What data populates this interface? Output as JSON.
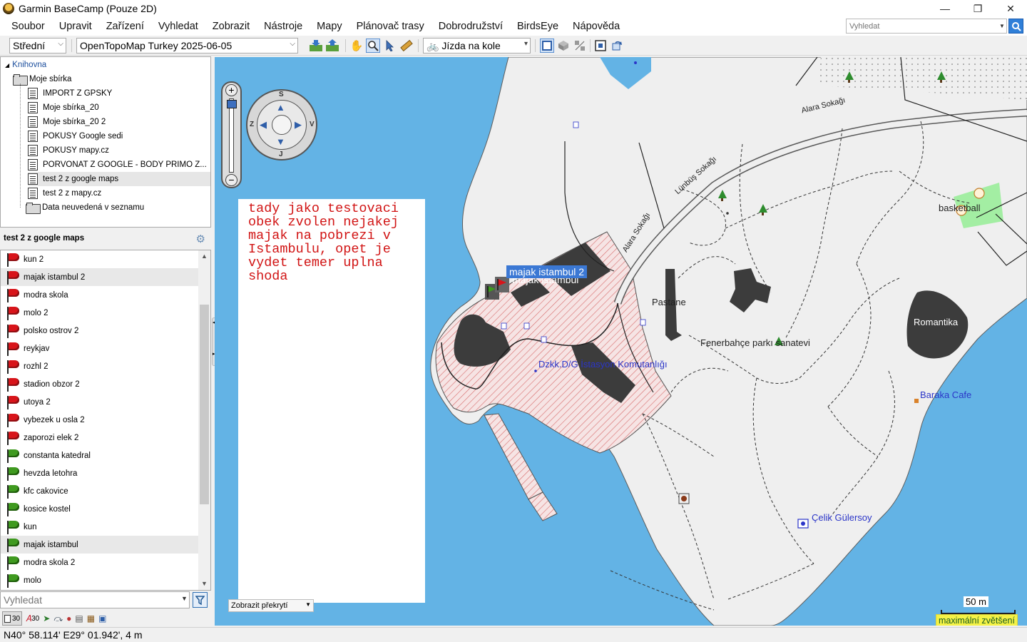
{
  "window": {
    "title": "Garmin BaseCamp (Pouze 2D)",
    "controls": [
      "—",
      "❐",
      "✕"
    ]
  },
  "menu": [
    "Soubor",
    "Upravit",
    "Zařízení",
    "Vyhledat",
    "Zobrazit",
    "Nástroje",
    "Mapy",
    "Plánovač trasy",
    "Dobrodružství",
    "BirdsEye",
    "Nápověda"
  ],
  "top_search": {
    "placeholder": "Vyhledat"
  },
  "toolbar": {
    "detail_level": "Střední",
    "map_product": "OpenTopoMap Turkey 2025-06-05",
    "activity_profile": "Jízda na kole"
  },
  "library": {
    "root": "Knihovna",
    "collection": "Moje sbírka",
    "items": [
      "IMPORT Z GPSKY",
      "Moje sbírka_20",
      "Moje sbírka_20 2",
      "POKUSY Google sedi",
      "POKUSY mapy.cz",
      "PORVONAT Z GOOGLE - BODY PRIMO Z...",
      "test 2 z google maps",
      "test 2 z mapy.cz"
    ],
    "selected_index": 6,
    "unlisted": "Data neuvedená v seznamu"
  },
  "list": {
    "header": "test 2 z google maps",
    "items": [
      {
        "label": "kun 2",
        "flag": "red"
      },
      {
        "label": "majak istambul 2",
        "flag": "red",
        "selected": true
      },
      {
        "label": "modra skola",
        "flag": "red"
      },
      {
        "label": "molo 2",
        "flag": "red"
      },
      {
        "label": "polsko ostrov 2",
        "flag": "red"
      },
      {
        "label": "reykjav",
        "flag": "red"
      },
      {
        "label": "rozhl 2",
        "flag": "red"
      },
      {
        "label": "stadion obzor 2",
        "flag": "red"
      },
      {
        "label": "utoya 2",
        "flag": "red"
      },
      {
        "label": "vybezek u osla 2",
        "flag": "red"
      },
      {
        "label": "zaporozi elek 2",
        "flag": "red"
      },
      {
        "label": "constanta katedral",
        "flag": "green"
      },
      {
        "label": "hevzda letohra",
        "flag": "green"
      },
      {
        "label": "kfc cakovice",
        "flag": "green"
      },
      {
        "label": "kosice kostel",
        "flag": "green"
      },
      {
        "label": "kun",
        "flag": "green"
      },
      {
        "label": "majak istambul",
        "flag": "green",
        "selected": true
      },
      {
        "label": "modra skola 2",
        "flag": "green"
      },
      {
        "label": "molo",
        "flag": "green"
      }
    ]
  },
  "search": {
    "placeholder": "Vyhledat"
  },
  "bottom_counts": {
    "lists": "30",
    "tracks": "30"
  },
  "map": {
    "note": "tady jako testovaci\nobek zvolen nejakej\nmajak na pobrezi v\nIstambulu, opet je\nvydet temer uplna\nshoda",
    "waypoint_label": "majak istambul 2",
    "waypoint_label_behind": "majak istambul",
    "labels": {
      "pastane": "Pastane",
      "park": "Fenerbahçe parkı sanatevi",
      "dzkk": "Dzkk.D/G İstasyon Komutanlığı",
      "romantika": "Romantika",
      "basketball": "basketball",
      "baraka": "Baraka Cafe",
      "celik": "Çelik Gülersoy",
      "road1": "Alara Sokağı",
      "road2": "Lünbüş Sokağı",
      "road3": "Alara Sokağı"
    },
    "overlay_select": "Zobrazit překrytí",
    "scale": "50 m",
    "zoom_status": "maximální zvětšení",
    "compass": {
      "n": "S",
      "s": "J",
      "w": "Z",
      "e": "V"
    }
  },
  "status": {
    "coords": "N40° 58.114' E29° 01.942', 4 m"
  },
  "colors": {
    "water": "#63b3e5",
    "land": "#efefef",
    "park": "#90ee90",
    "accent": "#3b78d4",
    "note_text": "#d11414"
  }
}
